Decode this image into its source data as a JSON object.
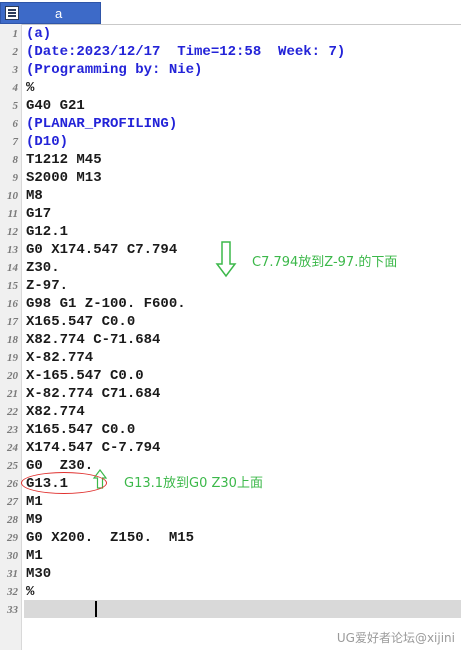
{
  "tab": {
    "label": "a",
    "icon": "nc-file-icon"
  },
  "lines": [
    {
      "n": "1",
      "text": "(a)",
      "type": "comment"
    },
    {
      "n": "2",
      "text": "(Date:2023/12/17  Time=12:58  Week: 7)",
      "type": "comment"
    },
    {
      "n": "3",
      "text": "(Programming by: Nie)",
      "type": "comment"
    },
    {
      "n": "4",
      "text": "%",
      "type": "code"
    },
    {
      "n": "5",
      "text": "G40 G21",
      "type": "code"
    },
    {
      "n": "6",
      "text": "(PLANAR_PROFILING)",
      "type": "comment"
    },
    {
      "n": "7",
      "text": "(D10)",
      "type": "comment"
    },
    {
      "n": "8",
      "text": "T1212 M45",
      "type": "code"
    },
    {
      "n": "9",
      "text": "S2000 M13",
      "type": "code"
    },
    {
      "n": "10",
      "text": "M8",
      "type": "code"
    },
    {
      "n": "11",
      "text": "G17",
      "type": "code"
    },
    {
      "n": "12",
      "text": "G12.1",
      "type": "code"
    },
    {
      "n": "13",
      "text": "G0 X174.547 C7.794",
      "type": "code"
    },
    {
      "n": "14",
      "text": "Z30.",
      "type": "code"
    },
    {
      "n": "15",
      "text": "Z-97.",
      "type": "code"
    },
    {
      "n": "16",
      "text": "G98 G1 Z-100. F600.",
      "type": "code"
    },
    {
      "n": "17",
      "text": "X165.547 C0.0",
      "type": "code"
    },
    {
      "n": "18",
      "text": "X82.774 C-71.684",
      "type": "code"
    },
    {
      "n": "19",
      "text": "X-82.774",
      "type": "code"
    },
    {
      "n": "20",
      "text": "X-165.547 C0.0",
      "type": "code"
    },
    {
      "n": "21",
      "text": "X-82.774 C71.684",
      "type": "code"
    },
    {
      "n": "22",
      "text": "X82.774",
      "type": "code"
    },
    {
      "n": "23",
      "text": "X165.547 C0.0",
      "type": "code"
    },
    {
      "n": "24",
      "text": "X174.547 C-7.794",
      "type": "code"
    },
    {
      "n": "25",
      "text": "G0  Z30.",
      "type": "code"
    },
    {
      "n": "26",
      "text": "G13.1",
      "type": "code"
    },
    {
      "n": "27",
      "text": "M1",
      "type": "code"
    },
    {
      "n": "28",
      "text": "M9",
      "type": "code"
    },
    {
      "n": "29",
      "text": "G0 X200.  Z150.  M15",
      "type": "code"
    },
    {
      "n": "30",
      "text": "M1",
      "type": "code"
    },
    {
      "n": "31",
      "text": "M30",
      "type": "code"
    },
    {
      "n": "32",
      "text": "%",
      "type": "code"
    },
    {
      "n": "33",
      "text": "",
      "type": "code"
    }
  ],
  "annotations": {
    "first": "C7.794放到Z-97.的下面",
    "second": "G13.1放到G0 Z30上面",
    "arrow_down_icon": "arrow-down-icon",
    "arrow_up_icon": "arrow-up-icon",
    "color": "#3cb84a"
  },
  "highlight_color": "#e0302e",
  "watermark": "UG爱好者论坛@xijini"
}
